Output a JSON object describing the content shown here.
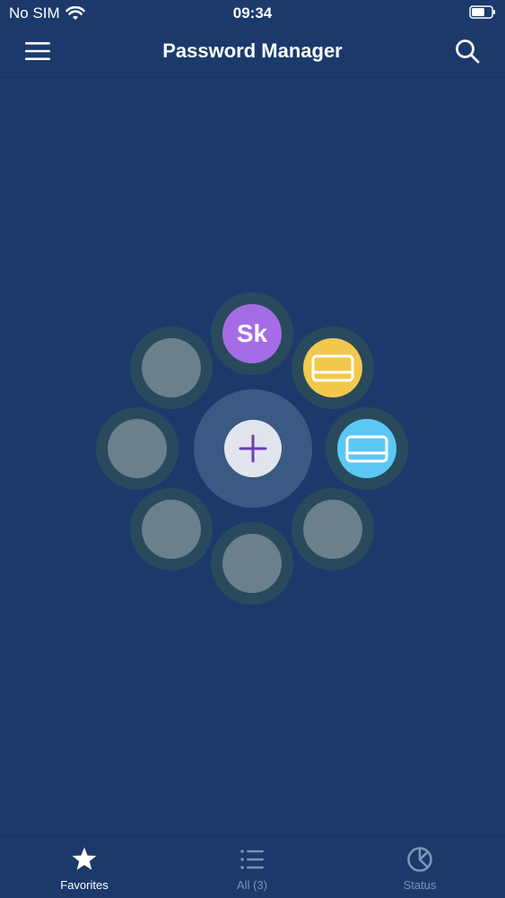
{
  "status_bar": {
    "carrier": "No SIM",
    "time": "09:34"
  },
  "nav": {
    "title": "Password Manager"
  },
  "favorites": {
    "add_icon": "plus-icon",
    "items": [
      {
        "type": "avatar",
        "initials": "Sk",
        "color": "#a66ce6"
      },
      {
        "type": "card",
        "icon": "card-icon",
        "color": "#f2c94c"
      },
      {
        "type": "card",
        "icon": "card-icon",
        "color": "#5ac8f5"
      }
    ],
    "empty_slot_color": "#6b808c"
  },
  "tabs": [
    {
      "label": "Favorites",
      "icon": "star-icon",
      "active": true
    },
    {
      "label": "All (3)",
      "icon": "list-icon",
      "active": false
    },
    {
      "label": "Status",
      "icon": "status-icon",
      "active": false
    }
  ],
  "colors": {
    "background": "#1b3a6b",
    "accent": "#6a3fb5"
  }
}
